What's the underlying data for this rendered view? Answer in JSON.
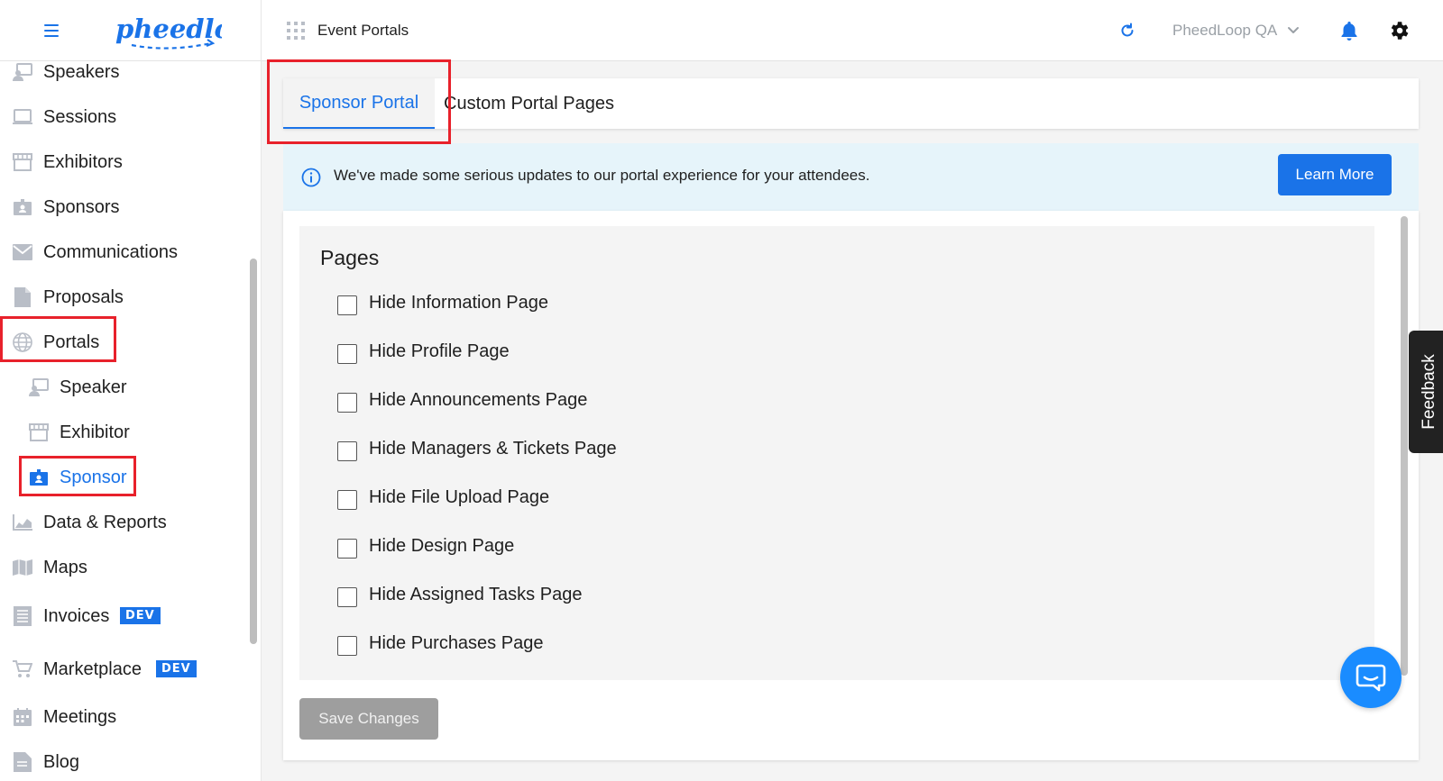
{
  "header": {
    "app_title": "Event Portals",
    "account_name": "PheedLoop QA",
    "logo_text": "pheedloop"
  },
  "sidebar": {
    "items": [
      {
        "label": "Speakers",
        "icon": "speaker-icon"
      },
      {
        "label": "Sessions",
        "icon": "monitor-icon"
      },
      {
        "label": "Exhibitors",
        "icon": "store-icon"
      },
      {
        "label": "Sponsors",
        "icon": "badge-icon"
      },
      {
        "label": "Communications",
        "icon": "mail-icon"
      },
      {
        "label": "Proposals",
        "icon": "document-icon"
      },
      {
        "label": "Portals",
        "icon": "globe-icon"
      },
      {
        "label": "Speaker",
        "icon": "speaker-icon",
        "sub": true
      },
      {
        "label": "Exhibitor",
        "icon": "store-icon",
        "sub": true
      },
      {
        "label": "Sponsor",
        "icon": "badge-icon",
        "sub": true,
        "active": true
      },
      {
        "label": "Data & Reports",
        "icon": "chart-icon"
      },
      {
        "label": "Maps",
        "icon": "map-icon"
      },
      {
        "label": "Invoices",
        "icon": "invoice-icon",
        "badge": "DEV"
      },
      {
        "label": "Marketplace",
        "icon": "cart-icon",
        "badge": "DEV"
      },
      {
        "label": "Meetings",
        "icon": "calendar-icon"
      },
      {
        "label": "Blog",
        "icon": "blog-icon"
      }
    ]
  },
  "tabs": [
    {
      "label": "Sponsor Portal",
      "active": true
    },
    {
      "label": "Custom Portal Pages",
      "active": false
    }
  ],
  "banner": {
    "text": "We've made some serious updates to our portal experience for your attendees.",
    "button_label": "Learn More"
  },
  "pages": {
    "title": "Pages",
    "options": [
      {
        "label": "Hide Information Page",
        "checked": false
      },
      {
        "label": "Hide Profile Page",
        "checked": false
      },
      {
        "label": "Hide Announcements Page",
        "checked": false
      },
      {
        "label": "Hide Managers & Tickets Page",
        "checked": false
      },
      {
        "label": "Hide File Upload Page",
        "checked": false
      },
      {
        "label": "Hide Design Page",
        "checked": false
      },
      {
        "label": "Hide Assigned Tasks Page",
        "checked": false
      },
      {
        "label": "Hide Purchases Page",
        "checked": false
      }
    ],
    "save_label": "Save Changes"
  },
  "feedback_label": "Feedback",
  "colors": {
    "accent": "#1a73e8",
    "highlight": "#e8212b",
    "banner_bg": "#e6f4fa",
    "disabled_button": "#9e9e9e"
  }
}
